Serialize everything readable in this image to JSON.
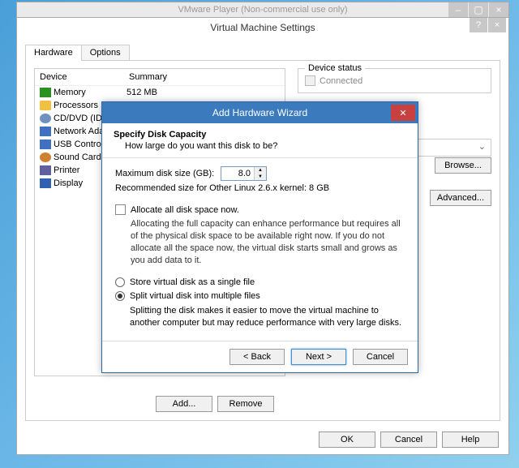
{
  "vmware": {
    "title": "VMware Player (Non-commercial use only)"
  },
  "settings": {
    "title": "Virtual Machine Settings",
    "tabs": [
      "Hardware",
      "Options"
    ],
    "headers": {
      "device": "Device",
      "summary": "Summary"
    },
    "devices": [
      {
        "name": "Memory",
        "summary": "512 MB",
        "icon": "mem"
      },
      {
        "name": "Processors",
        "summary": "",
        "icon": "proc"
      },
      {
        "name": "CD/DVD (IDE)",
        "summary": "",
        "icon": "cd"
      },
      {
        "name": "Network Adap",
        "summary": "",
        "icon": "net"
      },
      {
        "name": "USB Controller",
        "summary": "",
        "icon": "usb"
      },
      {
        "name": "Sound Card",
        "summary": "",
        "icon": "snd"
      },
      {
        "name": "Printer",
        "summary": "",
        "icon": "prn"
      },
      {
        "name": "Display",
        "summary": "",
        "icon": "disp"
      }
    ],
    "device_status": {
      "title": "Device status",
      "connected": "Connected"
    },
    "browse": "Browse...",
    "advanced": "Advanced...",
    "add": "Add...",
    "remove": "Remove",
    "ok": "OK",
    "cancel": "Cancel",
    "help": "Help"
  },
  "wizard": {
    "title": "Add Hardware Wizard",
    "header_main": "Specify Disk Capacity",
    "header_sub": "How large do you want this disk to be?",
    "max_size_label": "Maximum disk size (GB):",
    "max_size_value": "8.0",
    "recommended": "Recommended size for Other Linux 2.6.x kernel: 8 GB",
    "allocate_label": "Allocate all disk space now.",
    "allocate_desc": "Allocating the full capacity can enhance performance but requires all of the physical disk space to be available right now. If you do not allocate all the space now, the virtual disk starts small and grows as you add data to it.",
    "radio_single": "Store virtual disk as a single file",
    "radio_split": "Split virtual disk into multiple files",
    "split_desc": "Splitting the disk makes it easier to move the virtual machine to another computer but may reduce performance with very large disks.",
    "back": "< Back",
    "next": "Next >",
    "cancel": "Cancel"
  }
}
